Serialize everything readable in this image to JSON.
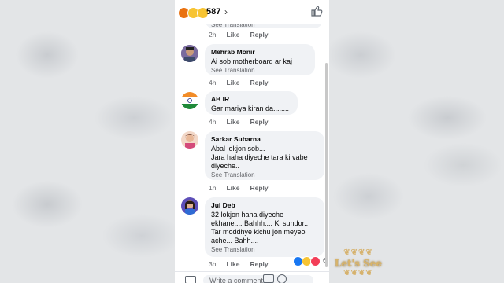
{
  "top_bar": {
    "reaction_count": "587",
    "chevron": "›"
  },
  "comments": [
    {
      "name": "",
      "text": "",
      "translation": "See Translation",
      "time": "2h",
      "like": "Like",
      "reply": "Reply"
    },
    {
      "name": "Mehrab Monir",
      "text": "Ai sob motherboard ar kaj",
      "translation": "See Translation",
      "time": "4h",
      "like": "Like",
      "reply": "Reply"
    },
    {
      "name": "AB  IR",
      "text": "Gar mariya kiran da........",
      "translation": "",
      "time": "4h",
      "like": "Like",
      "reply": "Reply"
    },
    {
      "name": "Sarkar Subarna",
      "text": "Abal lokjon sob...\nJara haha diyeche tara ki vabe\ndiyeche..",
      "translation": "See Translation",
      "time": "1h",
      "like": "Like",
      "reply": "Reply"
    },
    {
      "name": "Jui Deb",
      "text": "32 lokjon haha diyeche\nekhane.... Bahhh.... Ki sundor..\nTar moddhye kichu jon meyeo\nache... Bahh....",
      "translation": "See Translation",
      "time": "3h",
      "like": "Like",
      "reply": "Reply"
    }
  ],
  "last_comment_reactions": "6",
  "composer": {
    "placeholder": "Write a comment..."
  },
  "watermark": "Let's See",
  "colors": {
    "bubble": "#f0f2f5",
    "secondary_text": "#65676b",
    "watermark_gold": "#d9b46a"
  },
  "icons": [
    "angry-react-icon",
    "haha-react-icon",
    "sad-react-icon",
    "chevron-right-icon",
    "thumbs-up-icon",
    "camera-icon",
    "gif-icon",
    "emoji-icon"
  ]
}
